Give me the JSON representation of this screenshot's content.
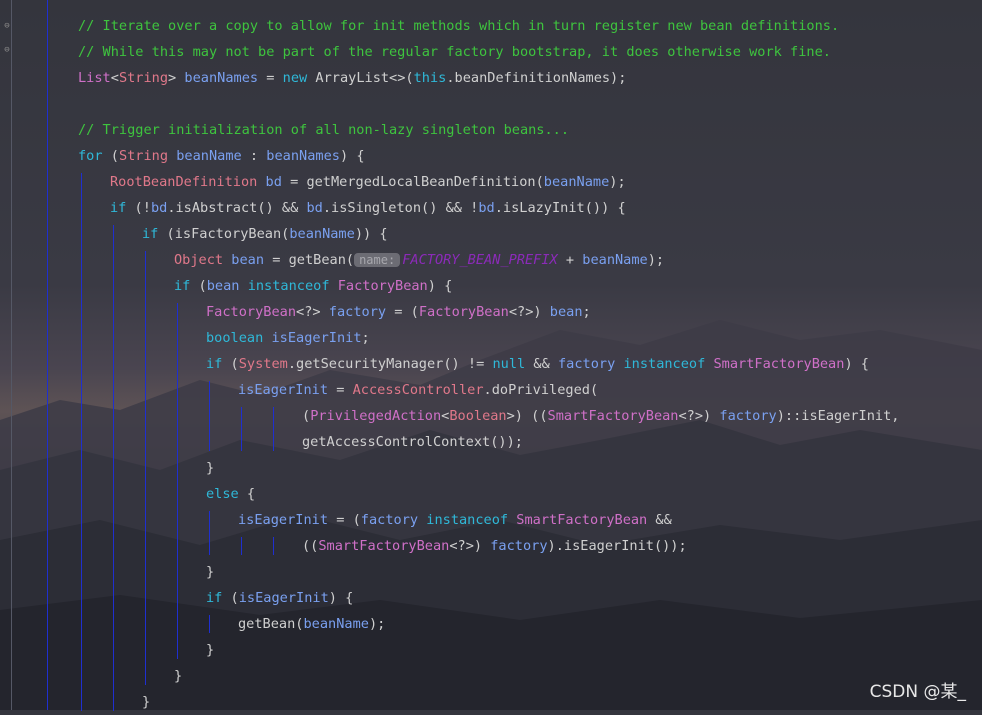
{
  "colors": {
    "comment": "#3ec43e",
    "keyword": "#2fb8d8",
    "type": "#e0788a",
    "variable": "#7aa0f0",
    "constant": "#8b2bb8",
    "guide": "#1f2fd0",
    "hint_bg": "#6c6c74"
  },
  "editor": {
    "lines": [
      {
        "indent": 0,
        "tokens": [
          {
            "k": "cm",
            "t": "// Iterate over a copy to allow for init methods which in turn register new bean definitions."
          }
        ]
      },
      {
        "indent": 0,
        "tokens": [
          {
            "k": "cm",
            "t": "// While this may not be part of the regular factory bootstrap, it does otherwise work fine."
          }
        ]
      },
      {
        "indent": 0,
        "tokens": [
          {
            "k": "ty2",
            "t": "List"
          },
          {
            "k": "pl",
            "t": "<"
          },
          {
            "k": "ty",
            "t": "String"
          },
          {
            "k": "pl",
            "t": "> "
          },
          {
            "k": "vr",
            "t": "beanNames"
          },
          {
            "k": "pl",
            "t": " = "
          },
          {
            "k": "kw",
            "t": "new"
          },
          {
            "k": "pl",
            "t": " ArrayList<>("
          },
          {
            "k": "kw",
            "t": "this"
          },
          {
            "k": "pl",
            "t": ".beanDefinitionNames);"
          }
        ]
      },
      {
        "indent": 0,
        "tokens": []
      },
      {
        "indent": 0,
        "tokens": [
          {
            "k": "cm",
            "t": "// Trigger initialization of all non-lazy singleton beans..."
          }
        ]
      },
      {
        "indent": 0,
        "tokens": [
          {
            "k": "kw",
            "t": "for"
          },
          {
            "k": "pl",
            "t": " ("
          },
          {
            "k": "ty",
            "t": "String"
          },
          {
            "k": "pl",
            "t": " "
          },
          {
            "k": "vr",
            "t": "beanName"
          },
          {
            "k": "pl",
            "t": " : "
          },
          {
            "k": "vr",
            "t": "beanNames"
          },
          {
            "k": "pl",
            "t": ") {"
          }
        ]
      },
      {
        "indent": 1,
        "tokens": [
          {
            "k": "ty",
            "t": "RootBeanDefinition"
          },
          {
            "k": "pl",
            "t": " "
          },
          {
            "k": "vr",
            "t": "bd"
          },
          {
            "k": "pl",
            "t": " = getMergedLocalBeanDefinition("
          },
          {
            "k": "vr",
            "t": "beanName"
          },
          {
            "k": "pl",
            "t": ");"
          }
        ]
      },
      {
        "indent": 1,
        "tokens": [
          {
            "k": "kw",
            "t": "if"
          },
          {
            "k": "pl",
            "t": " (!"
          },
          {
            "k": "vr",
            "t": "bd"
          },
          {
            "k": "pl",
            "t": ".isAbstract() && "
          },
          {
            "k": "vr",
            "t": "bd"
          },
          {
            "k": "pl",
            "t": ".isSingleton() && !"
          },
          {
            "k": "vr",
            "t": "bd"
          },
          {
            "k": "pl",
            "t": ".isLazyInit()) {"
          }
        ]
      },
      {
        "indent": 2,
        "tokens": [
          {
            "k": "kw",
            "t": "if"
          },
          {
            "k": "pl",
            "t": " (isFactoryBean("
          },
          {
            "k": "vr",
            "t": "beanName"
          },
          {
            "k": "pl",
            "t": ")) {"
          }
        ]
      },
      {
        "indent": 3,
        "tokens": [
          {
            "k": "ty",
            "t": "Object"
          },
          {
            "k": "pl",
            "t": " "
          },
          {
            "k": "vr",
            "t": "bean"
          },
          {
            "k": "pl",
            "t": " = getBean("
          },
          {
            "k": "hint",
            "t": "name:"
          },
          {
            "k": "cn",
            "t": "FACTORY_BEAN_PREFIX"
          },
          {
            "k": "pl",
            "t": " + "
          },
          {
            "k": "vr",
            "t": "beanName"
          },
          {
            "k": "pl",
            "t": ");"
          }
        ]
      },
      {
        "indent": 3,
        "tokens": [
          {
            "k": "kw",
            "t": "if"
          },
          {
            "k": "pl",
            "t": " ("
          },
          {
            "k": "vr",
            "t": "bean"
          },
          {
            "k": "pl",
            "t": " "
          },
          {
            "k": "kw",
            "t": "instanceof"
          },
          {
            "k": "pl",
            "t": " "
          },
          {
            "k": "ty2",
            "t": "FactoryBean"
          },
          {
            "k": "pl",
            "t": ") {"
          }
        ]
      },
      {
        "indent": 4,
        "tokens": [
          {
            "k": "ty2",
            "t": "FactoryBean"
          },
          {
            "k": "pl",
            "t": "<?> "
          },
          {
            "k": "vr",
            "t": "factory"
          },
          {
            "k": "pl",
            "t": " = ("
          },
          {
            "k": "ty2",
            "t": "FactoryBean"
          },
          {
            "k": "pl",
            "t": "<?>) "
          },
          {
            "k": "vr",
            "t": "bean"
          },
          {
            "k": "pl",
            "t": ";"
          }
        ]
      },
      {
        "indent": 4,
        "tokens": [
          {
            "k": "kw",
            "t": "boolean"
          },
          {
            "k": "pl",
            "t": " "
          },
          {
            "k": "vr",
            "t": "isEagerInit"
          },
          {
            "k": "pl",
            "t": ";"
          }
        ]
      },
      {
        "indent": 4,
        "tokens": [
          {
            "k": "kw",
            "t": "if"
          },
          {
            "k": "pl",
            "t": " ("
          },
          {
            "k": "ty",
            "t": "System"
          },
          {
            "k": "pl",
            "t": ".getSecurityManager() != "
          },
          {
            "k": "kw",
            "t": "null"
          },
          {
            "k": "pl",
            "t": " && "
          },
          {
            "k": "vr",
            "t": "factory"
          },
          {
            "k": "pl",
            "t": " "
          },
          {
            "k": "kw",
            "t": "instanceof"
          },
          {
            "k": "pl",
            "t": " "
          },
          {
            "k": "ty2",
            "t": "SmartFactoryBean"
          },
          {
            "k": "pl",
            "t": ") {"
          }
        ]
      },
      {
        "indent": 5,
        "tokens": [
          {
            "k": "vr",
            "t": "isEagerInit"
          },
          {
            "k": "pl",
            "t": " = "
          },
          {
            "k": "ty",
            "t": "AccessController"
          },
          {
            "k": "pl",
            "t": ".doPrivileged("
          }
        ]
      },
      {
        "indent": 7,
        "tokens": [
          {
            "k": "pl",
            "t": "("
          },
          {
            "k": "ty2",
            "t": "PrivilegedAction"
          },
          {
            "k": "pl",
            "t": "<"
          },
          {
            "k": "ty",
            "t": "Boolean"
          },
          {
            "k": "pl",
            "t": ">) (("
          },
          {
            "k": "ty2",
            "t": "SmartFactoryBean"
          },
          {
            "k": "pl",
            "t": "<?>) "
          },
          {
            "k": "vr",
            "t": "factory"
          },
          {
            "k": "pl",
            "t": ")::isEagerInit,"
          }
        ]
      },
      {
        "indent": 7,
        "tokens": [
          {
            "k": "pl",
            "t": "getAccessControlContext());"
          }
        ]
      },
      {
        "indent": 4,
        "tokens": [
          {
            "k": "pl",
            "t": "}"
          }
        ]
      },
      {
        "indent": 4,
        "tokens": [
          {
            "k": "kw",
            "t": "else"
          },
          {
            "k": "pl",
            "t": " {"
          }
        ]
      },
      {
        "indent": 5,
        "tokens": [
          {
            "k": "vr",
            "t": "isEagerInit"
          },
          {
            "k": "pl",
            "t": " = ("
          },
          {
            "k": "vr",
            "t": "factory"
          },
          {
            "k": "pl",
            "t": " "
          },
          {
            "k": "kw",
            "t": "instanceof"
          },
          {
            "k": "pl",
            "t": " "
          },
          {
            "k": "ty2",
            "t": "SmartFactoryBean"
          },
          {
            "k": "pl",
            "t": " &&"
          }
        ]
      },
      {
        "indent": 7,
        "tokens": [
          {
            "k": "pl",
            "t": "(("
          },
          {
            "k": "ty2",
            "t": "SmartFactoryBean"
          },
          {
            "k": "pl",
            "t": "<?>) "
          },
          {
            "k": "vr",
            "t": "factory"
          },
          {
            "k": "pl",
            "t": ").isEagerInit());"
          }
        ]
      },
      {
        "indent": 4,
        "tokens": [
          {
            "k": "pl",
            "t": "}"
          }
        ]
      },
      {
        "indent": 4,
        "tokens": [
          {
            "k": "kw",
            "t": "if"
          },
          {
            "k": "pl",
            "t": " ("
          },
          {
            "k": "vr",
            "t": "isEagerInit"
          },
          {
            "k": "pl",
            "t": ") {"
          }
        ]
      },
      {
        "indent": 5,
        "tokens": [
          {
            "k": "pl",
            "t": "getBean("
          },
          {
            "k": "vr",
            "t": "beanName"
          },
          {
            "k": "pl",
            "t": ");"
          }
        ]
      },
      {
        "indent": 4,
        "tokens": [
          {
            "k": "pl",
            "t": "}"
          }
        ]
      },
      {
        "indent": 3,
        "tokens": [
          {
            "k": "pl",
            "t": "}"
          }
        ]
      },
      {
        "indent": 2,
        "tokens": [
          {
            "k": "pl",
            "t": "}"
          }
        ]
      }
    ]
  },
  "watermark": "CSDN @某_"
}
